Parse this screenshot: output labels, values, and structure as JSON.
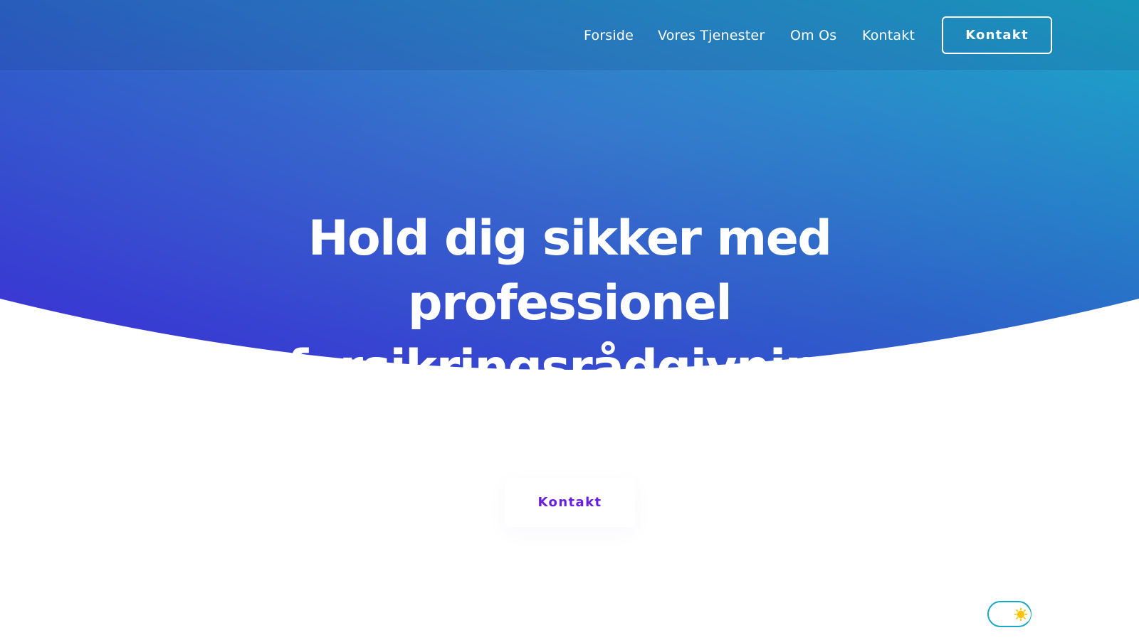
{
  "navigation": {
    "items": [
      {
        "label": "Forside"
      },
      {
        "label": "Vores Tjenester"
      },
      {
        "label": "Om Os"
      },
      {
        "label": "Kontakt"
      }
    ],
    "cta_label": "Kontakt"
  },
  "hero": {
    "title": "Hold dig sikker med professionel forsikringsrådgivning",
    "subtitle": "",
    "cta_label": "Kontakt"
  },
  "theme_toggle": {
    "icon": "sun-icon",
    "state": "light"
  },
  "colors": {
    "gradient_left": "#3d2fd6",
    "gradient_mid": "#2d62c9",
    "gradient_right": "#18a9c7",
    "cta_text": "#6a1fe0",
    "toggle_border": "#18a9c7",
    "sun": "#ffc400"
  }
}
